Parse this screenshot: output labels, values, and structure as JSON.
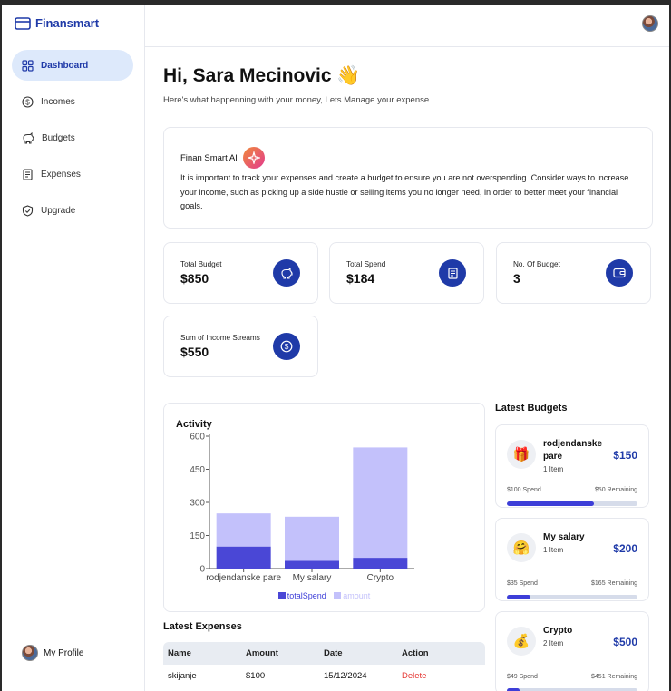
{
  "app": {
    "name": "Finansmart"
  },
  "sidebar": {
    "items": [
      {
        "label": "Dashboard",
        "icon": "dashboard-icon",
        "active": true
      },
      {
        "label": "Incomes",
        "icon": "dollar-circle-icon"
      },
      {
        "label": "Budgets",
        "icon": "piggy-bank-icon"
      },
      {
        "label": "Expenses",
        "icon": "receipt-icon"
      },
      {
        "label": "Upgrade",
        "icon": "shield-check-icon"
      }
    ],
    "profile_label": "My Profile"
  },
  "header": {
    "greeting": "Hi, Sara Mecinovic 👋",
    "subtitle": "Here's what happenning with your money, Lets Manage your expense"
  },
  "ai": {
    "title": "Finan Smart AI",
    "text": "It is important to track your expenses and create a budget to ensure you are not overspending. Consider ways to increase your income, such as picking up a side hustle or selling items you no longer need, in order to better meet your financial goals."
  },
  "stats": [
    {
      "label": "Total Budget",
      "value": "$850",
      "icon": "piggy-bank-icon"
    },
    {
      "label": "Total Spend",
      "value": "$184",
      "icon": "receipt-icon"
    },
    {
      "label": "No. Of Budget",
      "value": "3",
      "icon": "wallet-icon"
    },
    {
      "label": "Sum of Income Streams",
      "value": "$550",
      "icon": "dollar-circle-icon"
    }
  ],
  "chart_data": {
    "type": "bar",
    "title": "Activity",
    "categories": [
      "rodjendanske pare",
      "My salary",
      "Crypto"
    ],
    "series": [
      {
        "name": "totalSpend",
        "values": [
          100,
          35,
          49
        ],
        "color": "#4a47d6"
      },
      {
        "name": "amount",
        "values": [
          150,
          200,
          500
        ],
        "color": "#c3c1fb"
      }
    ],
    "stacked": true,
    "ylim": [
      0,
      600
    ],
    "yticks": [
      "0",
      "150",
      "300",
      "450",
      "600"
    ],
    "legend": "bottom"
  },
  "latest_expenses": {
    "title": "Latest Expenses",
    "columns": [
      "Name",
      "Amount",
      "Date",
      "Action"
    ],
    "rows": [
      {
        "name": "skijanje",
        "amount": "$100",
        "date": "15/12/2024",
        "action": "Delete"
      }
    ]
  },
  "latest_budgets": {
    "title": "Latest Budgets",
    "items": [
      {
        "emoji": "🎁",
        "name": "rodjendanske pare",
        "items": "1 Item",
        "amount": "$150",
        "spend": "$100 Spend",
        "remaining": "$50 Remaining",
        "progress": 0.67
      },
      {
        "emoji": "🤗",
        "name": "My salary",
        "items": "1 Item",
        "amount": "$200",
        "spend": "$35 Spend",
        "remaining": "$165 Remaining",
        "progress": 0.18
      },
      {
        "emoji": "💰",
        "name": "Crypto",
        "items": "2 Item",
        "amount": "$500",
        "spend": "$49 Spend",
        "remaining": "$451 Remaining",
        "progress": 0.1
      }
    ]
  },
  "colors": {
    "accent": "#1f3aa8",
    "active_bg": "#dde9fb",
    "bar_dark": "#4a47d6",
    "bar_light": "#c3c1fb",
    "danger": "#e53935"
  }
}
